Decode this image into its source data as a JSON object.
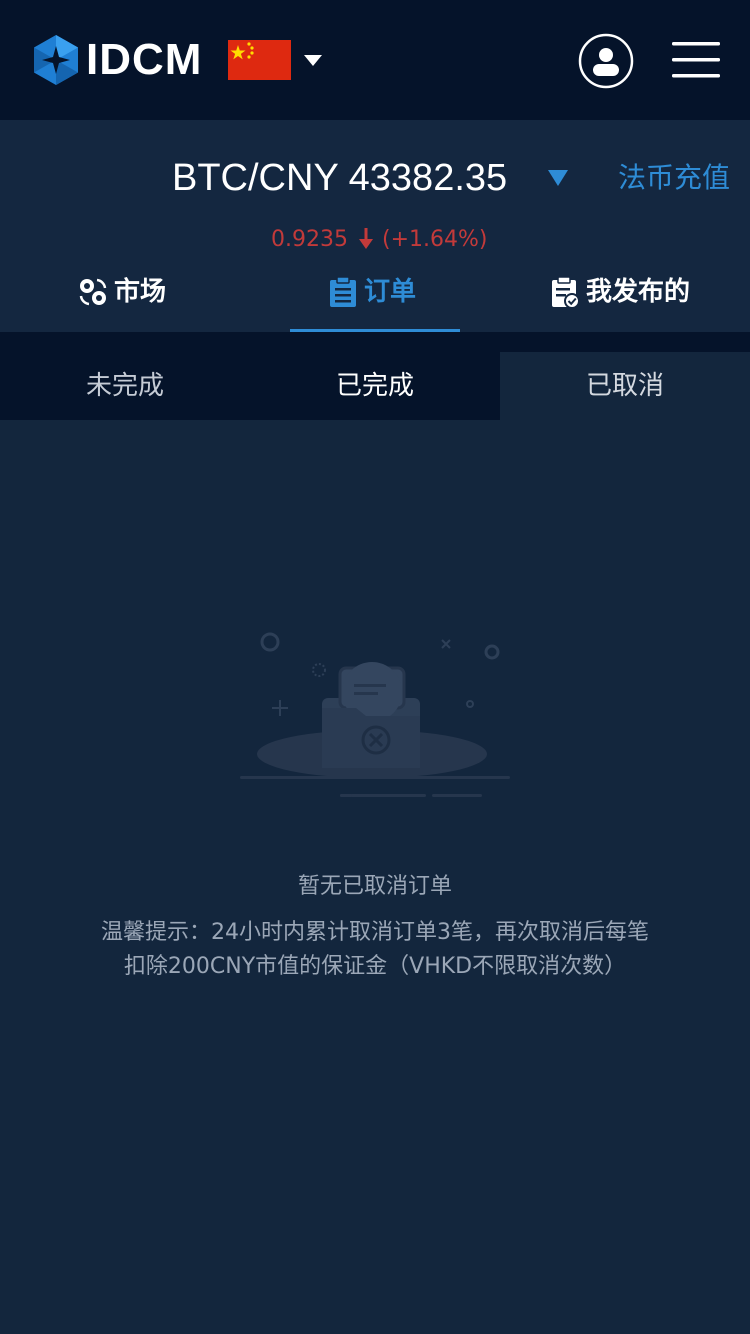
{
  "header": {
    "logo_text": "IDCM",
    "icons": [
      "idcm-logo-icon",
      "china-flag-icon",
      "caret-down-icon",
      "user-icon",
      "menu-icon"
    ]
  },
  "ticker": {
    "pair": "BTC/CNY 43382.35",
    "deposit_label": "法币充值",
    "change_value": "0.9235",
    "change_percent": "(+1.64%)",
    "change_color": "#c23a3a",
    "accent_color": "#2e8cd6"
  },
  "main_tabs": [
    {
      "label": "市场",
      "icon": "market-icon"
    },
    {
      "label": "订单",
      "icon": "clipboard-icon",
      "active": true
    },
    {
      "label": "我发布的",
      "icon": "published-icon"
    }
  ],
  "sub_tabs": [
    {
      "label": "未完成"
    },
    {
      "label": "已完成"
    },
    {
      "label": "已取消",
      "active": true
    }
  ],
  "empty_state": {
    "title": "暂无已取消订单",
    "tip_line1": "温馨提示：24小时内累计取消订单3笔，再次取消后每笔",
    "tip_line2": "扣除200CNY市值的保证金（VHKD不限取消次数）"
  }
}
